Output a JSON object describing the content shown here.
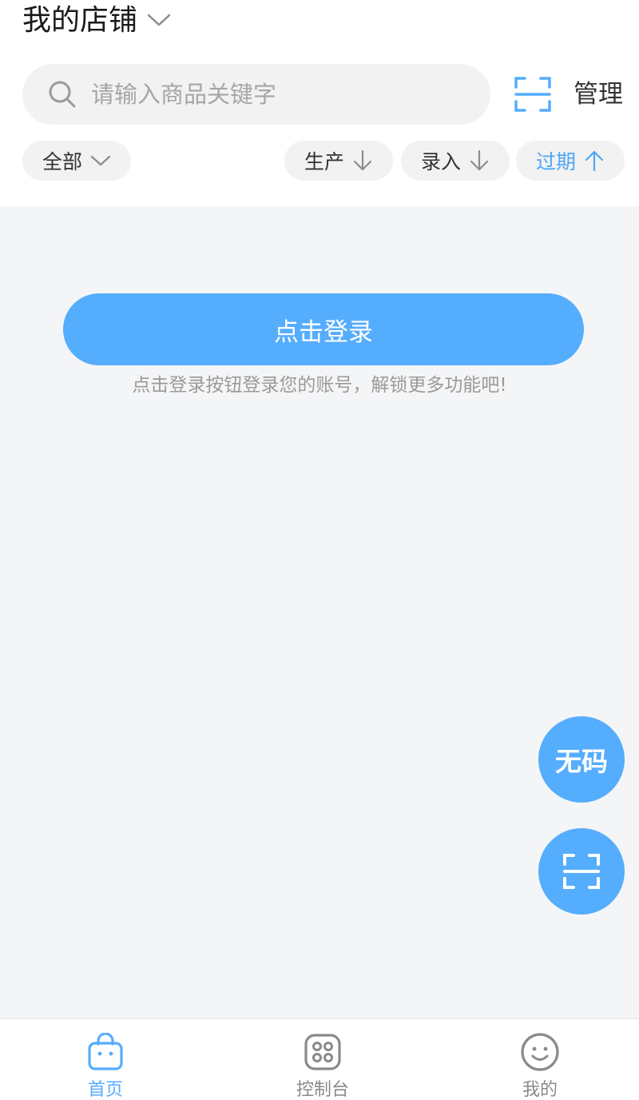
{
  "header": {
    "store_title": "我的店铺",
    "search_placeholder": "请输入商品关键字",
    "manage_label": "管理"
  },
  "filters": {
    "all_label": "全部",
    "production_label": "生产",
    "entry_label": "录入",
    "expiry_label": "过期"
  },
  "login": {
    "button_label": "点击登录",
    "hint": "点击登录按钮登录您的账号，解锁更多功能吧!"
  },
  "fab": {
    "nocode_label": "无码"
  },
  "tabbar": {
    "home_label": "首页",
    "console_label": "控制台",
    "mine_label": "我的"
  },
  "colors": {
    "accent": "#55adfd",
    "active_filter": "#4da6f5",
    "background": "#f4f5f7"
  },
  "icons": [
    "chevron-down-icon",
    "search-icon",
    "scan-icon",
    "arrow-down-icon",
    "arrow-up-icon",
    "bag-icon",
    "grid-icon",
    "smiley-icon"
  ]
}
